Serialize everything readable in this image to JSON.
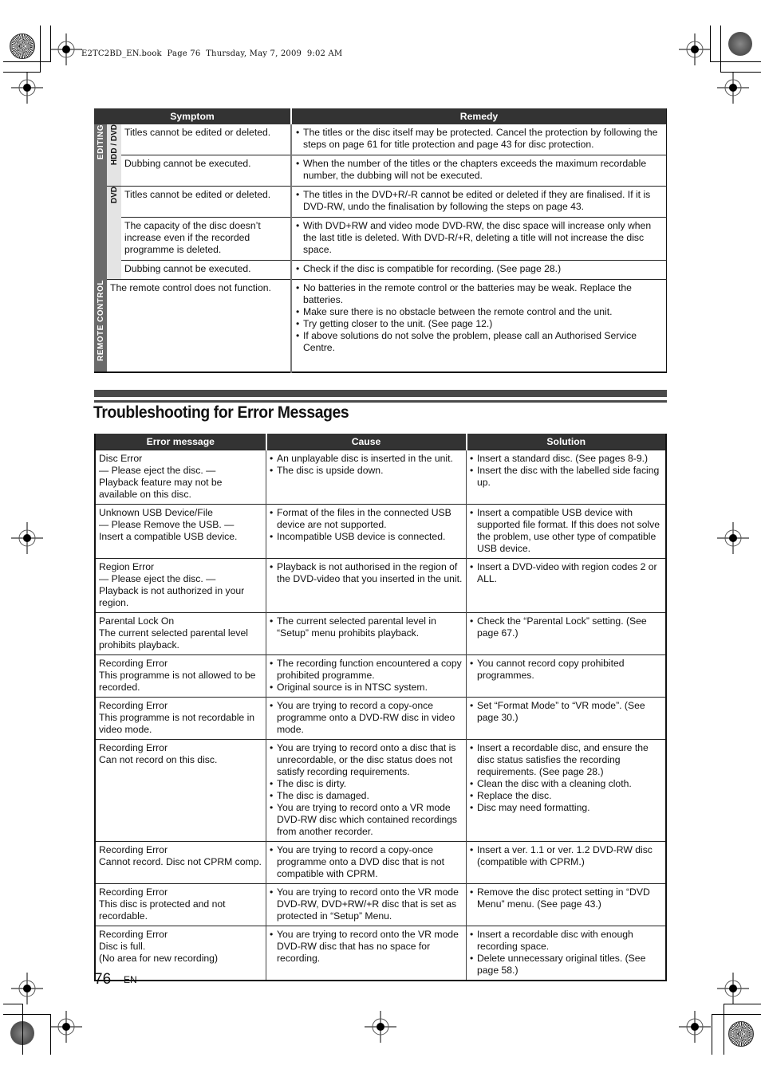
{
  "slug": "E2TC2BD_EN.book  Page 76  Thursday, May 7, 2009  9:02 AM",
  "symptom_table": {
    "headers": {
      "symptom": "Symptom",
      "remedy": "Remedy"
    },
    "categories": {
      "editing": "EDITING",
      "hdd_dvd": "HDD / DVD",
      "dvd": "DVD",
      "remote_control": "REMOTE CONTROL"
    },
    "rows": [
      {
        "symptom": "Titles cannot be edited or deleted.",
        "remedy": [
          "The titles or the disc itself may be protected. Cancel the protection by following the steps on page 61 for title protection and page 43 for disc protection."
        ]
      },
      {
        "symptom": "Dubbing cannot be executed.",
        "remedy": [
          "When the number of the titles or the chapters exceeds the maximum recordable number, the dubbing will not be executed."
        ]
      },
      {
        "symptom": "Titles cannot be edited or deleted.",
        "remedy": [
          "The titles in the DVD+R/-R cannot be edited or deleted if they are finalised. If it is DVD-RW, undo the finalisation by following the steps on page 43."
        ]
      },
      {
        "symptom": "The capacity of the disc doesn’t increase even if the recorded programme is deleted.",
        "remedy": [
          "With DVD+RW and video mode DVD-RW, the disc space will increase only when the last title is deleted. With DVD-R/+R, deleting a title will not increase the disc space."
        ]
      },
      {
        "symptom": "Dubbing cannot be executed.",
        "remedy": [
          "Check if the disc is compatible for recording. (See page 28.)"
        ]
      },
      {
        "symptom": "The remote control does not function.",
        "remedy": [
          "No batteries in the remote control or the batteries may be weak. Replace the batteries.",
          "Make sure there is no obstacle between the remote control and the unit.",
          "Try getting closer to the unit. (See page 12.)",
          "If above solutions do not solve the problem, please call an Authorised Service Centre."
        ]
      }
    ]
  },
  "section_title": "Troubleshooting for Error Messages",
  "error_table": {
    "headers": {
      "message": "Error message",
      "cause": "Cause",
      "solution": "Solution"
    },
    "rows": [
      {
        "message": [
          "Disc Error",
          "— Please eject the disc. —",
          "Playback feature may not be available on this disc."
        ],
        "cause": [
          "An unplayable disc is inserted in the unit.",
          "The disc is upside down."
        ],
        "solution": [
          "Insert a standard disc. (See pages 8-9.)",
          "Insert the disc with the labelled side facing up."
        ]
      },
      {
        "message": [
          "Unknown USB Device/File",
          "— Please Remove the USB. —",
          "Insert a compatible USB device."
        ],
        "cause": [
          "Format of the files in the connected USB device are not supported.",
          "Incompatible USB device is connected."
        ],
        "solution": [
          "Insert a compatible USB device with supported file format. If this does not solve the problem, use other type of compatible USB device."
        ]
      },
      {
        "message": [
          "Region Error",
          "— Please eject the disc. —",
          "Playback is not authorized in your region."
        ],
        "cause": [
          "Playback is not authorised in the region of the DVD-video that you inserted in the unit."
        ],
        "solution": [
          "Insert a DVD-video with region codes 2 or ALL."
        ]
      },
      {
        "message": [
          "Parental Lock On",
          "The current selected parental level prohibits playback."
        ],
        "cause": [
          "The current selected parental level in “Setup” menu prohibits playback."
        ],
        "solution": [
          "Check the “Parental Lock” setting. (See page 67.)"
        ]
      },
      {
        "message": [
          "Recording Error",
          "This programme is not allowed to be recorded."
        ],
        "cause": [
          "The recording function encountered a copy prohibited programme.",
          "Original source is in NTSC system."
        ],
        "solution": [
          "You cannot record copy prohibited programmes."
        ]
      },
      {
        "message": [
          "Recording Error",
          "This programme is not recordable in video mode."
        ],
        "cause": [
          "You are trying to record a copy-once programme onto a DVD-RW disc in video mode."
        ],
        "solution": [
          "Set “Format Mode” to “VR mode”. (See page 30.)"
        ]
      },
      {
        "message": [
          "Recording Error",
          "Can not record on this disc."
        ],
        "cause": [
          "You are trying to record onto a disc that is unrecordable, or the disc status does not satisfy recording requirements.",
          "The disc is dirty.",
          "The disc is damaged.",
          "You are trying to record onto a VR mode DVD-RW disc which contained recordings from another recorder."
        ],
        "solution": [
          "Insert a recordable disc, and ensure the disc status satisfies the recording requirements. (See page 28.)",
          "Clean the disc with a cleaning cloth.",
          "Replace the disc.",
          "Disc may need formatting."
        ]
      },
      {
        "message": [
          "Recording Error",
          "Cannot record. Disc not CPRM comp."
        ],
        "cause": [
          "You are trying to record a copy-once programme onto a DVD disc that is not compatible with CPRM."
        ],
        "solution": [
          "Insert a ver. 1.1 or ver. 1.2 DVD-RW disc (compatible with CPRM.)"
        ]
      },
      {
        "message": [
          "Recording Error",
          "This disc is protected and not recordable."
        ],
        "cause": [
          "You are trying to record onto the VR mode DVD-RW, DVD+RW/+R disc that is set as protected in “Setup” Menu."
        ],
        "solution": [
          "Remove the disc protect setting in “DVD Menu” menu. (See page 43.)"
        ]
      },
      {
        "message": [
          "Recording Error",
          "Disc is full.",
          "(No area for new recording)"
        ],
        "cause": [
          "You are trying to record onto the VR mode DVD-RW disc that has no space for recording."
        ],
        "solution": [
          "Insert a recordable disc with enough recording space.",
          "Delete unnecessary original titles. (See page 58.)"
        ]
      }
    ]
  },
  "footer": {
    "page_number": "76",
    "language": "EN"
  }
}
